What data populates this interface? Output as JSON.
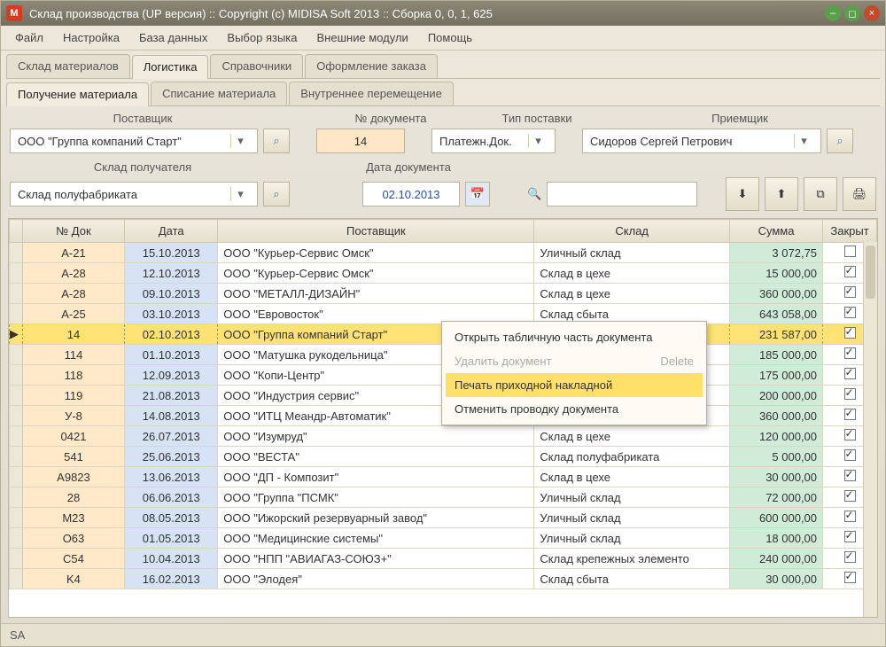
{
  "title": "Склад производства (UP версия) :: Copyright (c) MIDISA Soft 2013 :: Сборка 0, 0, 1, 625",
  "app_icon_letter": "M",
  "menu": [
    "Файл",
    "Настройка",
    "База данных",
    "Выбор языка",
    "Внешние модули",
    "Помощь"
  ],
  "tabs_top": {
    "items": [
      "Склад материалов",
      "Логистика",
      "Справочники",
      "Оформление заказа"
    ],
    "active": 1
  },
  "tabs_sub": {
    "items": [
      "Получение материала",
      "Списание материала",
      "Внутреннее перемещение"
    ],
    "active": 0
  },
  "filters": {
    "labels": {
      "supplier": "Поставщик",
      "doc_no": "№ документа",
      "delivery_type": "Тип поставки",
      "receiver": "Приемщик",
      "dest_wh": "Склад получателя",
      "doc_date": "Дата документа"
    },
    "values": {
      "supplier": "ООО \"Группа компаний Старт\"",
      "doc_no": "14",
      "delivery_type": "Платежн.Док.",
      "receiver": "Сидоров Сергей Петрович",
      "dest_wh": "Склад полуфабриката",
      "doc_date": "02.10.2013",
      "search": ""
    }
  },
  "grid": {
    "headers": [
      "№ Док",
      "Дата",
      "Поставщик",
      "Склад",
      "Сумма",
      "Закрыт"
    ],
    "selected_index": 4,
    "rows": [
      {
        "doc": "A-21",
        "date": "15.10.2013",
        "supp": "ООО \"Курьер-Сервис Омск\"",
        "wh": "Уличный склад",
        "sum": "3 072,75",
        "closed": false
      },
      {
        "doc": "A-28",
        "date": "12.10.2013",
        "supp": "ООО \"Курьер-Сервис Омск\"",
        "wh": "Склад в цехе",
        "sum": "15 000,00",
        "closed": true
      },
      {
        "doc": "A-28",
        "date": "09.10.2013",
        "supp": "ООО \"МЕТАЛЛ-ДИЗАЙН\"",
        "wh": "Склад в цехе",
        "sum": "360 000,00",
        "closed": true
      },
      {
        "doc": "A-25",
        "date": "03.10.2013",
        "supp": "ООО \"Евровосток\"",
        "wh": "Склад сбыта",
        "sum": "643 058,00",
        "closed": true
      },
      {
        "doc": "14",
        "date": "02.10.2013",
        "supp": "ООО \"Группа компаний Старт\"",
        "wh": "",
        "sum": "231 587,00",
        "closed": true
      },
      {
        "doc": "114",
        "date": "01.10.2013",
        "supp": "ООО \"Матушка рукодельница\"",
        "wh": "",
        "sum": "185 000,00",
        "closed": true
      },
      {
        "doc": "118",
        "date": "12.09.2013",
        "supp": "ООО \"Копи-Центр\"",
        "wh": "",
        "sum": "175 000,00",
        "closed": true
      },
      {
        "doc": "119",
        "date": "21.08.2013",
        "supp": "ООО \"Индустрия сервис\"",
        "wh": "",
        "sum": "200 000,00",
        "closed": true
      },
      {
        "doc": "У-8",
        "date": "14.08.2013",
        "supp": "ООО \"ИТЦ Меандр-Автоматик\"",
        "wh": "",
        "sum": "360 000,00",
        "closed": true
      },
      {
        "doc": "0421",
        "date": "26.07.2013",
        "supp": "ООО \"Изумруд\"",
        "wh": "Склад в цехе",
        "sum": "120 000,00",
        "closed": true
      },
      {
        "doc": "541",
        "date": "25.06.2013",
        "supp": "ООО \"ВЕСТА\"",
        "wh": "Склад полуфабриката",
        "sum": "5 000,00",
        "closed": true
      },
      {
        "doc": "A9823",
        "date": "13.06.2013",
        "supp": "ООО \"ДП - Композит\"",
        "wh": "Склад в цехе",
        "sum": "30 000,00",
        "closed": true
      },
      {
        "doc": "28",
        "date": "06.06.2013",
        "supp": "ООО \"Группа \"ПСМК\"",
        "wh": "Уличный склад",
        "sum": "72 000,00",
        "closed": true
      },
      {
        "doc": "M23",
        "date": "08.05.2013",
        "supp": "ООО \"Ижорский резервуарный завод\"",
        "wh": "Уличный склад",
        "sum": "600 000,00",
        "closed": true
      },
      {
        "doc": "O63",
        "date": "01.05.2013",
        "supp": "ООО \"Медицинские системы\"",
        "wh": "Уличный склад",
        "sum": "18 000,00",
        "closed": true
      },
      {
        "doc": "C54",
        "date": "10.04.2013",
        "supp": "ООО \"НПП \"АВИАГАЗ-СОЮЗ+\"",
        "wh": "Склад крепежных элементо",
        "sum": "240 000,00",
        "closed": true
      },
      {
        "doc": "K4",
        "date": "16.02.2013",
        "supp": "ООО \"Элодея\"",
        "wh": "Склад сбыта",
        "sum": "30 000,00",
        "closed": true
      }
    ]
  },
  "context_menu": {
    "items": [
      {
        "label": "Открыть табличную часть документа",
        "shortcut": "",
        "state": "normal"
      },
      {
        "label": "Удалить документ",
        "shortcut": "Delete",
        "state": "disabled"
      },
      {
        "label": "Печать приходной накладной",
        "shortcut": "",
        "state": "hover"
      },
      {
        "label": "Отменить проводку документа",
        "shortcut": "",
        "state": "normal"
      }
    ]
  },
  "status": "SA"
}
